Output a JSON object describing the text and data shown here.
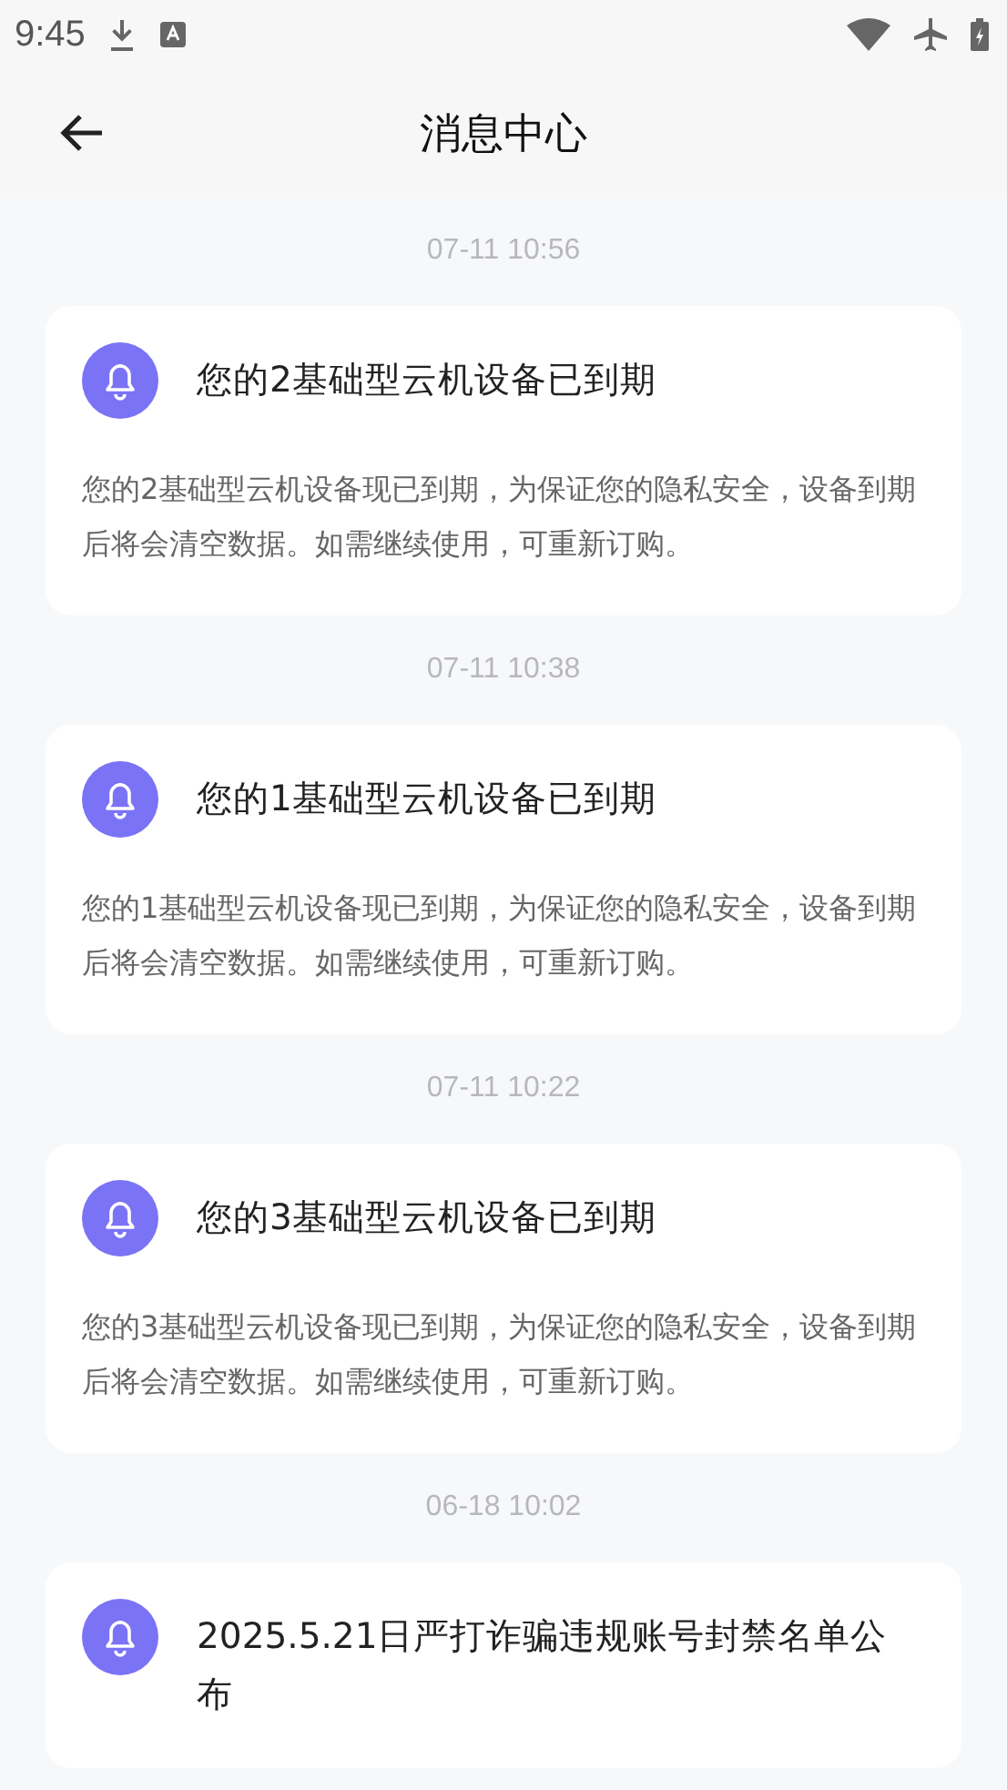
{
  "status_bar": {
    "time": "9:45"
  },
  "header": {
    "title": "消息中心"
  },
  "messages": [
    {
      "time": "07-11 10:56",
      "title": "您的2基础型云机设备已到期",
      "body": "您的2基础型云机设备现已到期，为保证您的隐私安全，设备到期后将会清空数据。如需继续使用，可重新订购。"
    },
    {
      "time": "07-11 10:38",
      "title": "您的1基础型云机设备已到期",
      "body": "您的1基础型云机设备现已到期，为保证您的隐私安全，设备到期后将会清空数据。如需继续使用，可重新订购。"
    },
    {
      "time": "07-11 10:22",
      "title": "您的3基础型云机设备已到期",
      "body": "您的3基础型云机设备现已到期，为保证您的隐私安全，设备到期后将会清空数据。如需继续使用，可重新订购。"
    },
    {
      "time": "06-18 10:02",
      "title": "2025.5.21日严打诈骗违规账号封禁名单公布"
    }
  ]
}
